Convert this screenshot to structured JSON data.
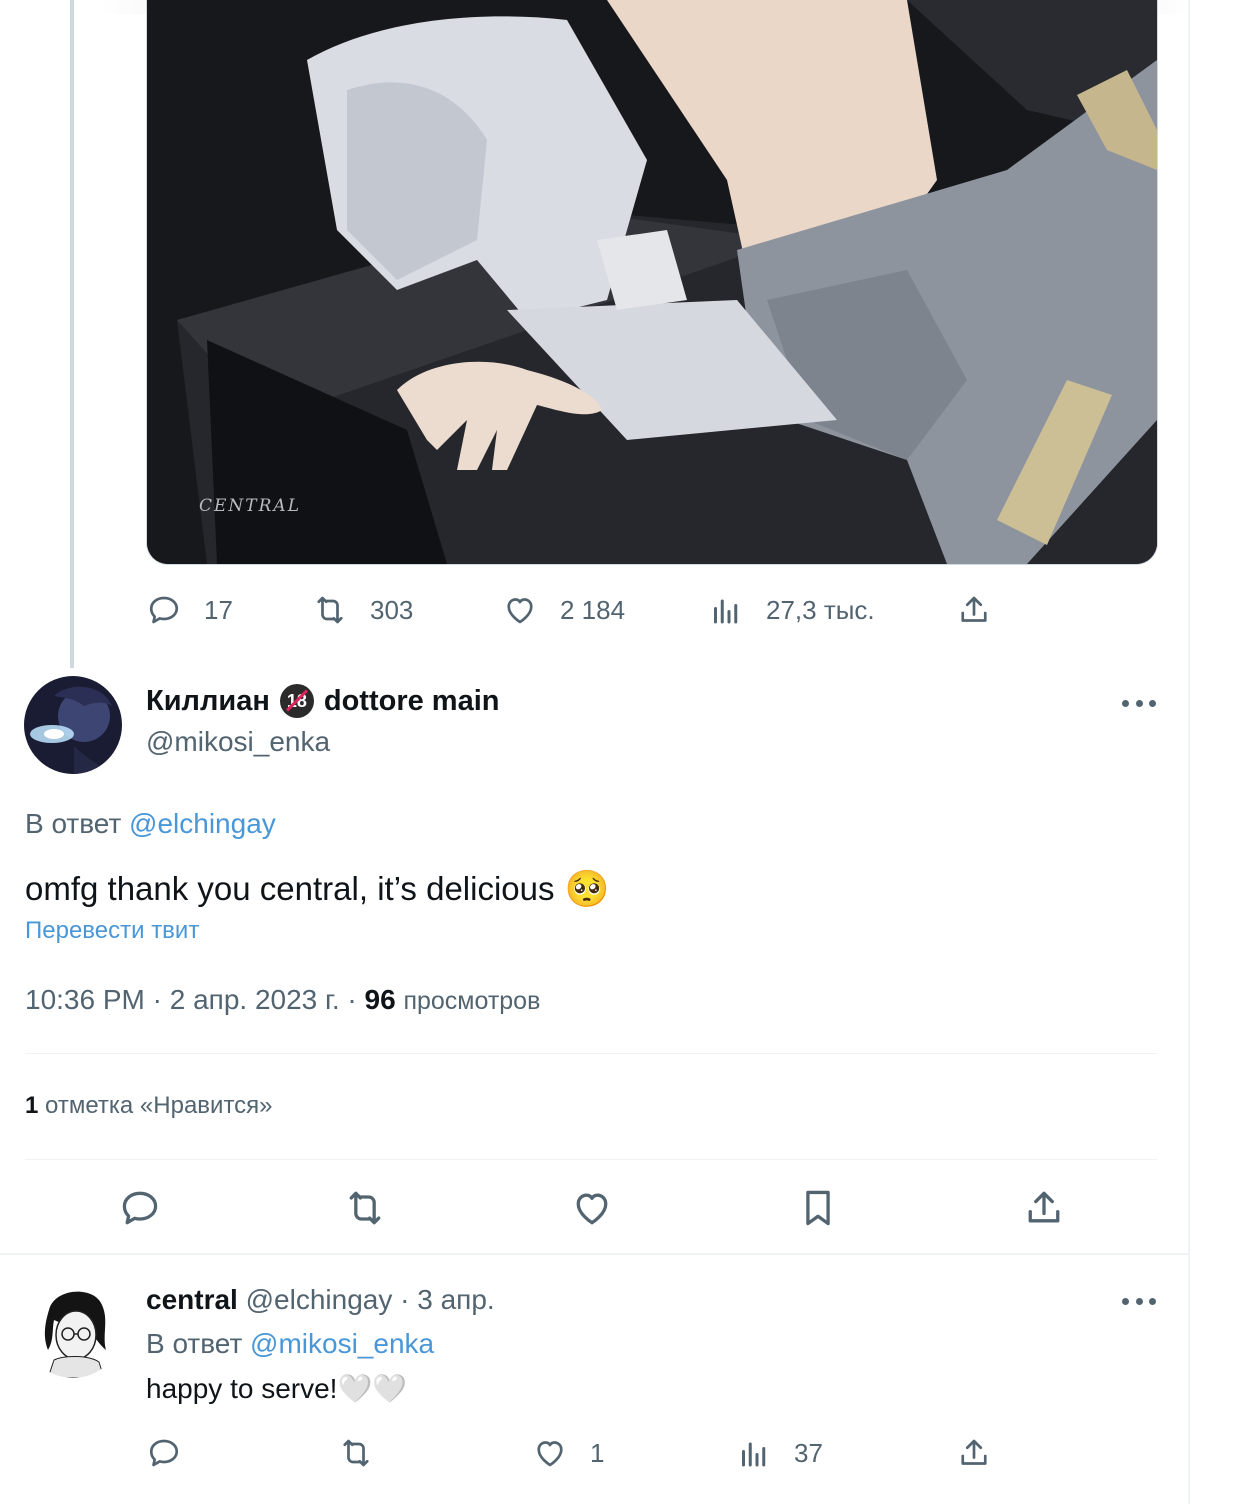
{
  "prev_tweet": {
    "watermark": "CENTRAL",
    "actions": {
      "replies": "17",
      "retweets": "303",
      "likes": "2 184",
      "views": "27,3 тыс."
    }
  },
  "main_tweet": {
    "display_name": "Киллиан",
    "badge": "18",
    "display_name_suffix": "dottore main",
    "handle": "@mikosi_enka",
    "reply_prefix": "В ответ",
    "reply_to": "@elchingay",
    "text": "omfg thank you central, it’s delicious",
    "emoji": "🥺",
    "translate": "Перевести твит",
    "time": "10:36 PM",
    "date": "2 апр. 2023 г.",
    "views_count": "96",
    "views_label": "просмотров",
    "likes_count": "1",
    "likes_label": "отметка «Нравится»"
  },
  "reply_tweet": {
    "display_name": "central",
    "handle": "@elchingay",
    "date": "3 апр.",
    "reply_prefix": "В ответ",
    "reply_to": "@mikosi_enka",
    "text": "happy to serve!",
    "emoji": "🤍🤍",
    "actions": {
      "likes": "1",
      "views": "37"
    }
  },
  "colors": {
    "text": "#0f1419",
    "muted": "#536471",
    "link": "#4a97d8",
    "divider": "#eff3f4"
  }
}
